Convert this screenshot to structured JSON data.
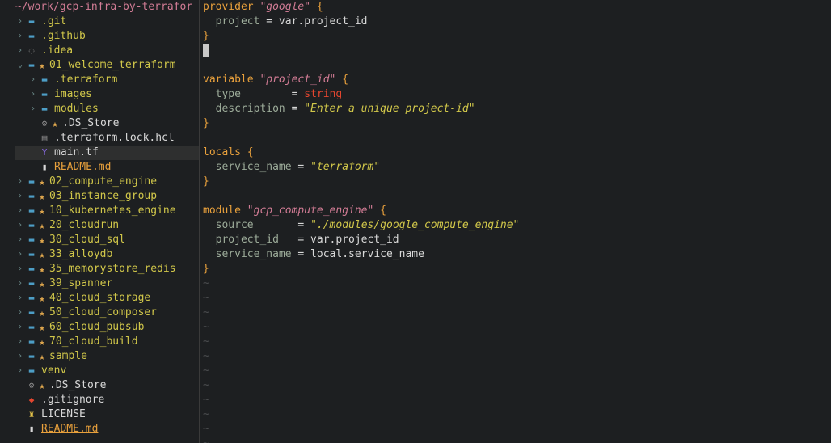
{
  "tree": {
    "root": "~/work/gcp-infra-by-terrafor",
    "items": [
      {
        "label": ".git",
        "depth": 0,
        "kind": "folder",
        "arrow": "›",
        "icon": "folder-icon",
        "star": false
      },
      {
        "label": ".github",
        "depth": 0,
        "kind": "folder",
        "arrow": "›",
        "icon": "folder-icon",
        "star": false
      },
      {
        "label": ".idea",
        "depth": 0,
        "kind": "folder",
        "arrow": "›",
        "icon": "dotted-circle-icon",
        "star": false
      },
      {
        "label": "01_welcome_terraform",
        "depth": 0,
        "kind": "folder",
        "arrow": "⌄",
        "icon": "folder-icon",
        "star": true
      },
      {
        "label": ".terraform",
        "depth": 1,
        "kind": "folder",
        "arrow": "›",
        "icon": "folder-icon",
        "star": false
      },
      {
        "label": "images",
        "depth": 1,
        "kind": "folder",
        "arrow": "›",
        "icon": "folder-icon",
        "star": false
      },
      {
        "label": "modules",
        "depth": 1,
        "kind": "folder",
        "arrow": "›",
        "icon": "folder-icon",
        "star": false
      },
      {
        "label": ".DS_Store",
        "depth": 1,
        "kind": "file",
        "arrow": "",
        "icon": "gear-icon",
        "star": true
      },
      {
        "label": ".terraform.lock.hcl",
        "depth": 1,
        "kind": "file",
        "arrow": "",
        "icon": "file-icon",
        "star": false
      },
      {
        "label": "main.tf",
        "depth": 1,
        "kind": "file",
        "arrow": "",
        "icon": "terraform-icon",
        "star": false,
        "active": true
      },
      {
        "label": "README.md",
        "depth": 1,
        "kind": "file",
        "arrow": "",
        "icon": "markdown-icon",
        "star": false,
        "modified": true
      },
      {
        "label": "02_compute_engine",
        "depth": 0,
        "kind": "folder",
        "arrow": "›",
        "icon": "folder-icon",
        "star": true
      },
      {
        "label": "03_instance_group",
        "depth": 0,
        "kind": "folder",
        "arrow": "›",
        "icon": "folder-icon",
        "star": true
      },
      {
        "label": "10_kubernetes_engine",
        "depth": 0,
        "kind": "folder",
        "arrow": "›",
        "icon": "folder-icon",
        "star": true
      },
      {
        "label": "20_cloudrun",
        "depth": 0,
        "kind": "folder",
        "arrow": "›",
        "icon": "folder-icon",
        "star": true
      },
      {
        "label": "30_cloud_sql",
        "depth": 0,
        "kind": "folder",
        "arrow": "›",
        "icon": "folder-icon",
        "star": true
      },
      {
        "label": "33_alloydb",
        "depth": 0,
        "kind": "folder",
        "arrow": "›",
        "icon": "folder-icon",
        "star": true
      },
      {
        "label": "35_memorystore_redis",
        "depth": 0,
        "kind": "folder",
        "arrow": "›",
        "icon": "folder-icon",
        "star": true
      },
      {
        "label": "39_spanner",
        "depth": 0,
        "kind": "folder",
        "arrow": "›",
        "icon": "folder-icon",
        "star": true
      },
      {
        "label": "40_cloud_storage",
        "depth": 0,
        "kind": "folder",
        "arrow": "›",
        "icon": "folder-icon",
        "star": true
      },
      {
        "label": "50_cloud_composer",
        "depth": 0,
        "kind": "folder",
        "arrow": "›",
        "icon": "folder-icon",
        "star": true
      },
      {
        "label": "60_cloud_pubsub",
        "depth": 0,
        "kind": "folder",
        "arrow": "›",
        "icon": "folder-icon",
        "star": true
      },
      {
        "label": "70_cloud_build",
        "depth": 0,
        "kind": "folder",
        "arrow": "›",
        "icon": "folder-icon",
        "star": true
      },
      {
        "label": "sample",
        "depth": 0,
        "kind": "folder",
        "arrow": "›",
        "icon": "folder-icon",
        "star": true
      },
      {
        "label": "venv",
        "depth": 0,
        "kind": "folder",
        "arrow": "›",
        "icon": "folder-icon",
        "star": false
      },
      {
        "label": ".DS_Store",
        "depth": 0,
        "kind": "file",
        "arrow": "",
        "icon": "gear-icon",
        "star": true
      },
      {
        "label": ".gitignore",
        "depth": 0,
        "kind": "file",
        "arrow": "",
        "icon": "git-icon",
        "star": false
      },
      {
        "label": "LICENSE",
        "depth": 0,
        "kind": "file",
        "arrow": "",
        "icon": "license-icon",
        "star": false
      },
      {
        "label": "README.md",
        "depth": 0,
        "kind": "file",
        "arrow": "",
        "icon": "markdown-icon",
        "star": false,
        "modified": true
      }
    ]
  },
  "editor": {
    "lines": [
      [
        {
          "t": "provider ",
          "c": "kw"
        },
        {
          "t": "\"google\"",
          "c": "str"
        },
        {
          "t": " {",
          "c": "brace"
        }
      ],
      [
        {
          "t": "  project",
          "c": "attr"
        },
        {
          "t": " = var.project_id",
          "c": "val"
        }
      ],
      [
        {
          "t": "}",
          "c": "brace"
        }
      ],
      [
        {
          "t": "",
          "c": "cursor"
        }
      ],
      [],
      [
        {
          "t": "variable ",
          "c": "kw"
        },
        {
          "t": "\"project_id\"",
          "c": "str"
        },
        {
          "t": " {",
          "c": "brace"
        }
      ],
      [
        {
          "t": "  type",
          "c": "attr"
        },
        {
          "t": "        = ",
          "c": "val"
        },
        {
          "t": "string",
          "c": "type-val"
        }
      ],
      [
        {
          "t": "  description",
          "c": "attr"
        },
        {
          "t": " = ",
          "c": "val"
        },
        {
          "t": "\"Enter a unique project-id\"",
          "c": "str-y"
        }
      ],
      [
        {
          "t": "}",
          "c": "brace"
        }
      ],
      [],
      [
        {
          "t": "locals",
          "c": "kw"
        },
        {
          "t": " {",
          "c": "brace"
        }
      ],
      [
        {
          "t": "  service_name",
          "c": "attr"
        },
        {
          "t": " = ",
          "c": "val"
        },
        {
          "t": "\"terraform\"",
          "c": "str-y"
        }
      ],
      [
        {
          "t": "}",
          "c": "brace"
        }
      ],
      [],
      [
        {
          "t": "module ",
          "c": "kw"
        },
        {
          "t": "\"gcp_compute_engine\"",
          "c": "str"
        },
        {
          "t": " {",
          "c": "brace"
        }
      ],
      [
        {
          "t": "  source",
          "c": "attr"
        },
        {
          "t": "       = ",
          "c": "val"
        },
        {
          "t": "\"./modules/google_compute_engine\"",
          "c": "str-y"
        }
      ],
      [
        {
          "t": "  project_id",
          "c": "attr"
        },
        {
          "t": "   = var.project_id",
          "c": "val"
        }
      ],
      [
        {
          "t": "  service_name",
          "c": "attr"
        },
        {
          "t": " = local.service_name",
          "c": "val"
        }
      ],
      [
        {
          "t": "}",
          "c": "brace"
        }
      ]
    ],
    "tilde": "~",
    "tilde_count": 12
  },
  "colors": {
    "background": "#1d1f21",
    "keyword": "#e8a03c",
    "string_pink": "#d27c95",
    "string_yellow": "#d1c74a",
    "folder": "#4d9ec6"
  }
}
